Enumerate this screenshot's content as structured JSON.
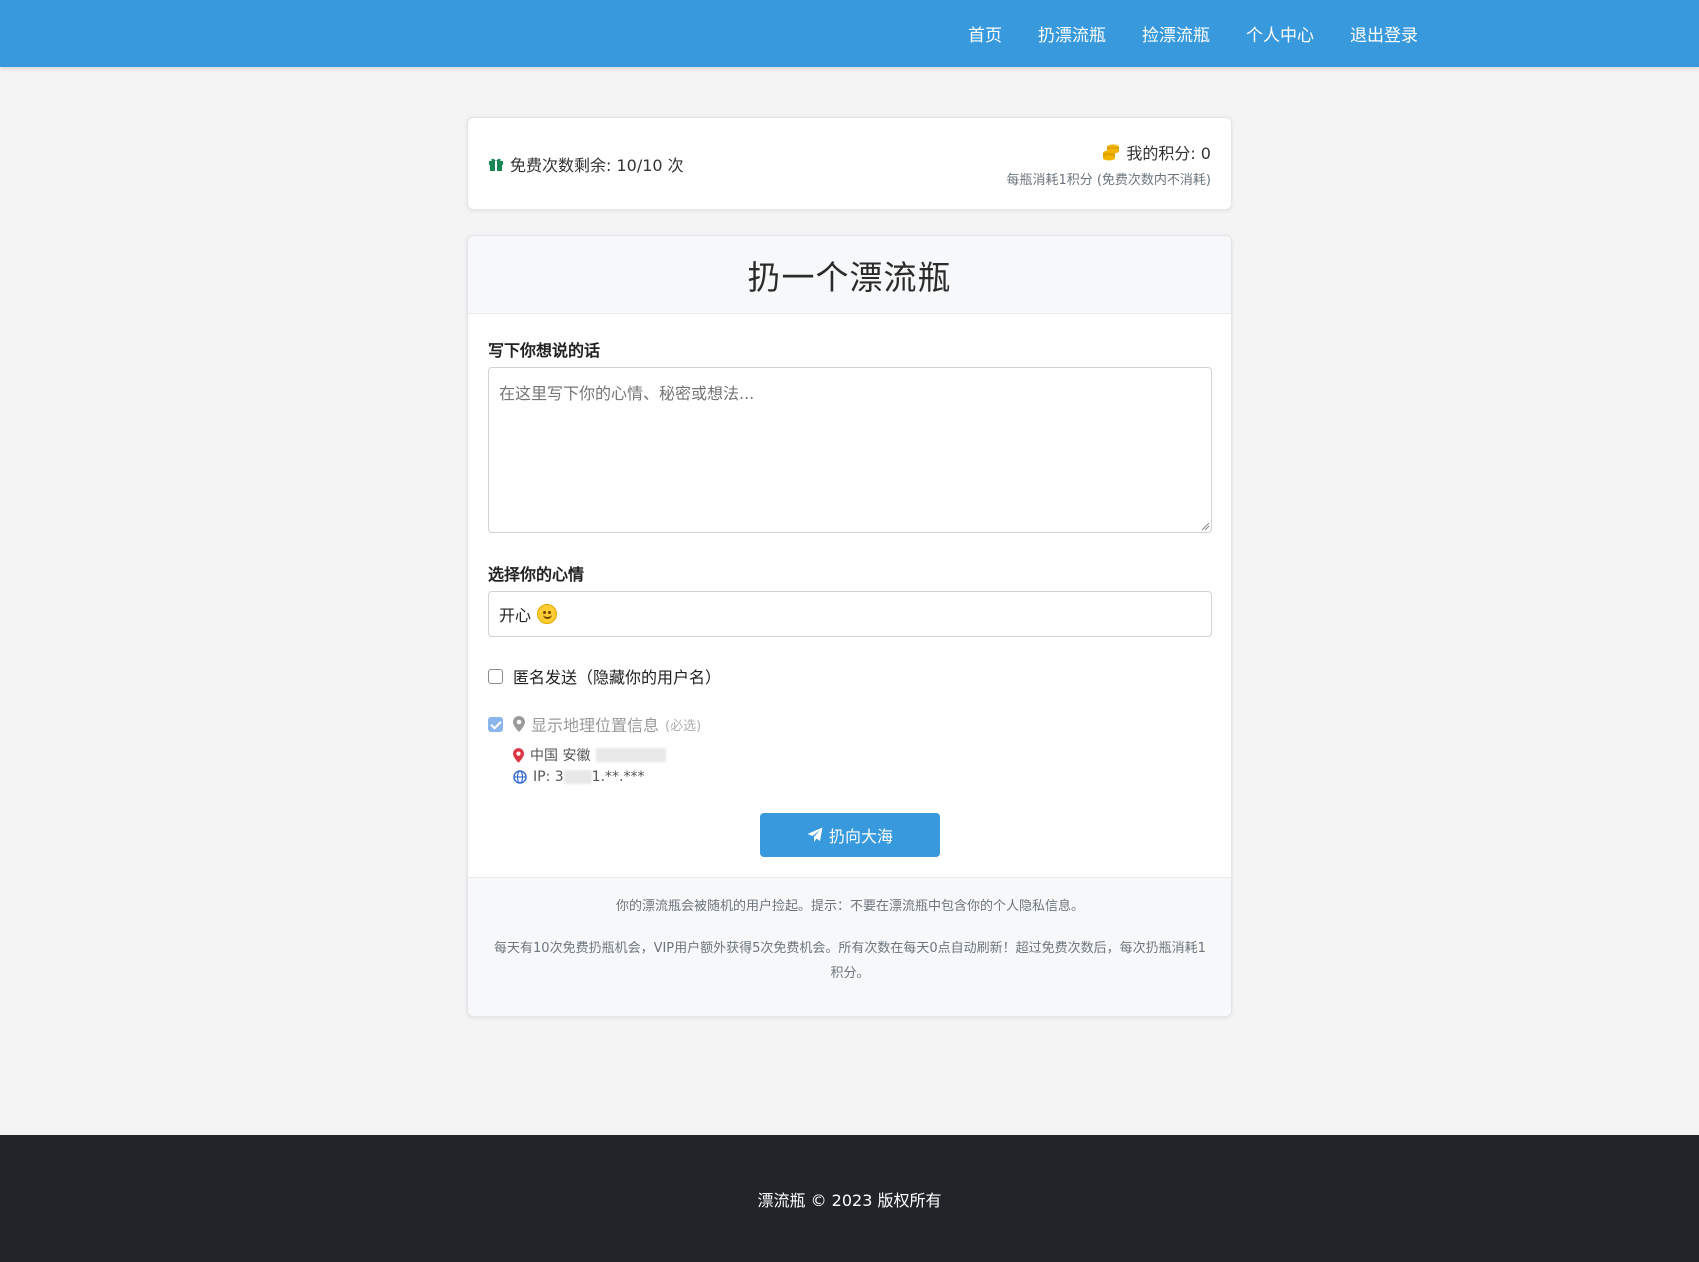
{
  "nav": {
    "items": [
      {
        "label": "首页"
      },
      {
        "label": "扔漂流瓶"
      },
      {
        "label": "捡漂流瓶"
      },
      {
        "label": "个人中心"
      },
      {
        "label": "退出登录"
      }
    ]
  },
  "stats": {
    "free_count_text": "免费次数剩余: 10/10 次",
    "points_text": "我的积分: 0",
    "points_note": "每瓶消耗1积分 (免费次数内不消耗)"
  },
  "form": {
    "title": "扔一个漂流瓶",
    "message_label": "写下你想说的话",
    "message_placeholder": "在这里写下你的心情、秘密或想法...",
    "mood_label": "选择你的心情",
    "mood_value": "开心",
    "anonymous_label": "匿名发送（隐藏你的用户名）",
    "location_label": "显示地理位置信息",
    "location_required": "(必选)",
    "location_text": "中国 安徽",
    "ip_prefix": "IP: 3",
    "ip_suffix": "1.**.***",
    "submit_label": "扔向大海"
  },
  "footer_note": {
    "line1": "你的漂流瓶会被随机的用户捡起。提示：不要在漂流瓶中包含你的个人隐私信息。",
    "line2": "每天有10次免费扔瓶机会，VIP用户额外获得5次免费机会。所有次数在每天0点自动刷新！超过免费次数后，每次扔瓶消耗1积分。"
  },
  "site_footer": {
    "copyright": "漂流瓶 © 2023 版权所有"
  },
  "colors": {
    "primary": "#3899dc",
    "footer_bg": "#212529",
    "page_bg": "#f4f4f4"
  }
}
